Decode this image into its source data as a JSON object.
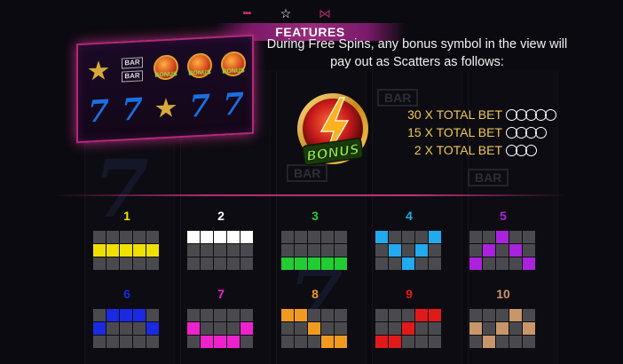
{
  "topbar": {
    "icons": [
      {
        "name": "paytable-grid-icon"
      },
      {
        "name": "favorite-star-icon"
      },
      {
        "name": "pattern-icon"
      }
    ]
  },
  "banner": {
    "title": "FEATURES"
  },
  "reel_preview": {
    "rows": [
      [
        "star",
        "bar",
        "bonus",
        "bonus",
        "bonus"
      ],
      [
        "seven",
        "seven",
        "star",
        "seven",
        "seven"
      ]
    ],
    "bonus_label": "BONUS"
  },
  "description": "During Free Spins, any bonus symbol in the view will pay out as Scatters as follows:",
  "bonus_symbol": {
    "label": "BONUS"
  },
  "paytable": [
    {
      "label": "30 X TOTAL BET",
      "count": 5
    },
    {
      "label": "15 X TOTAL BET",
      "count": 4
    },
    {
      "label": "2 X TOTAL BET",
      "count": 3
    }
  ],
  "paylines": [
    {
      "number": "1",
      "color": "#f0e000",
      "cells": [
        [
          1,
          0
        ],
        [
          1,
          1
        ],
        [
          1,
          2
        ],
        [
          1,
          3
        ],
        [
          1,
          4
        ]
      ]
    },
    {
      "number": "2",
      "color": "#ffffff",
      "cells": [
        [
          0,
          0
        ],
        [
          0,
          1
        ],
        [
          0,
          2
        ],
        [
          0,
          3
        ],
        [
          0,
          4
        ]
      ]
    },
    {
      "number": "3",
      "color": "#22cc33",
      "cells": [
        [
          2,
          0
        ],
        [
          2,
          1
        ],
        [
          2,
          2
        ],
        [
          2,
          3
        ],
        [
          2,
          4
        ]
      ]
    },
    {
      "number": "4",
      "color": "#22aaee",
      "cells": [
        [
          0,
          0
        ],
        [
          1,
          1
        ],
        [
          2,
          2
        ],
        [
          1,
          3
        ],
        [
          0,
          4
        ]
      ]
    },
    {
      "number": "5",
      "color": "#aa22dd",
      "cells": [
        [
          2,
          0
        ],
        [
          1,
          1
        ],
        [
          0,
          2
        ],
        [
          1,
          3
        ],
        [
          2,
          4
        ]
      ]
    },
    {
      "number": "6",
      "color": "#1a2ae0",
      "cells": [
        [
          1,
          0
        ],
        [
          0,
          1
        ],
        [
          0,
          2
        ],
        [
          0,
          3
        ],
        [
          1,
          4
        ]
      ]
    },
    {
      "number": "7",
      "color": "#ee22cc",
      "cells": [
        [
          1,
          0
        ],
        [
          2,
          1
        ],
        [
          2,
          2
        ],
        [
          2,
          3
        ],
        [
          1,
          4
        ]
      ]
    },
    {
      "number": "8",
      "color": "#f09a20",
      "cells": [
        [
          0,
          0
        ],
        [
          0,
          1
        ],
        [
          1,
          2
        ],
        [
          2,
          3
        ],
        [
          2,
          4
        ]
      ]
    },
    {
      "number": "9",
      "color": "#e01a1a",
      "cells": [
        [
          2,
          0
        ],
        [
          2,
          1
        ],
        [
          1,
          2
        ],
        [
          0,
          3
        ],
        [
          0,
          4
        ]
      ]
    },
    {
      "number": "10",
      "color": "#c8966a",
      "cells": [
        [
          1,
          0
        ],
        [
          2,
          1
        ],
        [
          1,
          2
        ],
        [
          0,
          3
        ],
        [
          1,
          4
        ]
      ]
    }
  ],
  "colors": {
    "accent": "#b82a7a",
    "paytable_text": "#f0c850",
    "number_colors": [
      "#f0e000",
      "#ffffff",
      "#22cc33",
      "#22aaee",
      "#aa22dd",
      "#1a2ae0",
      "#ee22cc",
      "#f09a20",
      "#e01a1a",
      "#c8966a"
    ]
  }
}
